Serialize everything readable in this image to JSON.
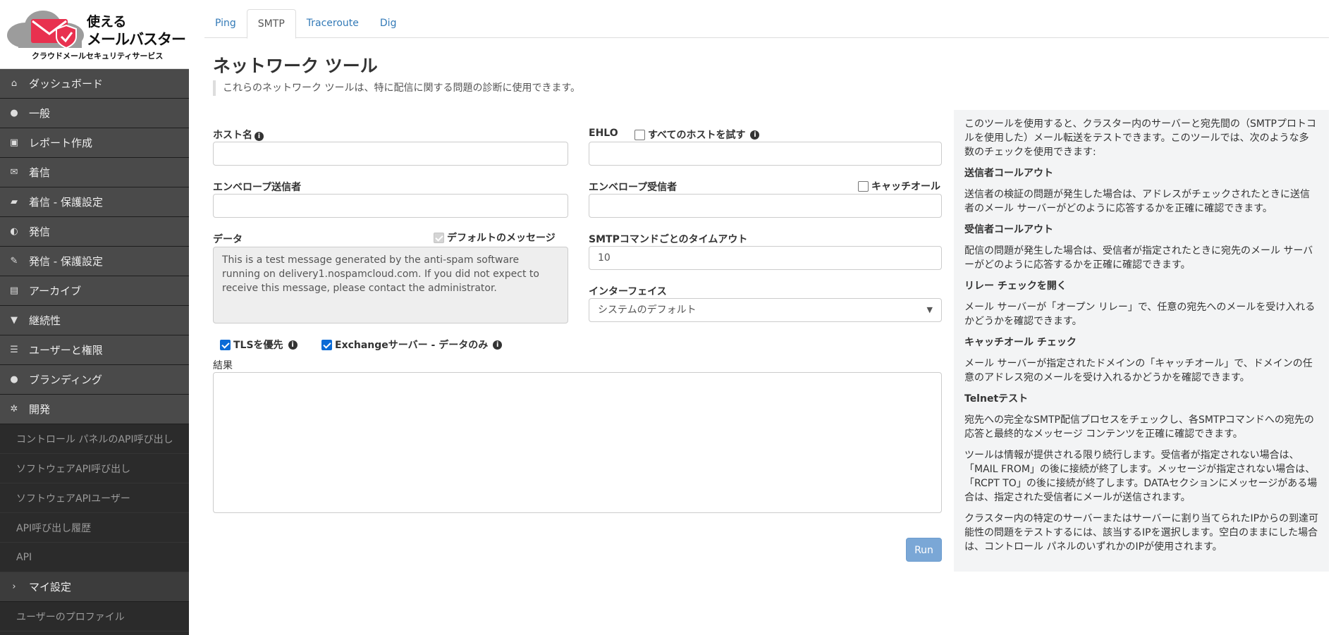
{
  "brand": {
    "name_line1": "使える",
    "name_line2": "メールバスター",
    "tagline": "クラウドメールセキュリティサービス"
  },
  "sidebar": {
    "items": [
      {
        "icon": "home-icon",
        "glyph": "⌂",
        "label": "ダッシュボード"
      },
      {
        "icon": "globe-icon",
        "glyph": "●",
        "label": "一般"
      },
      {
        "icon": "inbox-icon",
        "glyph": "▣",
        "label": "レポート作成"
      },
      {
        "icon": "envelope-icon",
        "glyph": "✉",
        "label": "着信"
      },
      {
        "icon": "folder-open-icon",
        "glyph": "▰",
        "label": "着信 - 保護設定"
      },
      {
        "icon": "half-circle-icon",
        "glyph": "◐",
        "label": "発信"
      },
      {
        "icon": "wrench-icon",
        "glyph": "✎",
        "label": "発信 - 保護設定"
      },
      {
        "icon": "file-icon",
        "glyph": "▤",
        "label": "アーカイブ"
      },
      {
        "icon": "filter-icon",
        "glyph": "▼",
        "label": "継続性"
      },
      {
        "icon": "list-icon",
        "glyph": "☰",
        "label": "ユーザーと権限"
      },
      {
        "icon": "user-icon",
        "glyph": "●",
        "label": "ブランディング"
      },
      {
        "icon": "cog-icon",
        "glyph": "✲",
        "label": "開発"
      }
    ],
    "dev_sub": [
      "コントロール パネルのAPI呼び出し",
      "ソフトウェアAPI呼び出し",
      "ソフトウェアAPIユーザー",
      "API呼び出し履歴",
      "API"
    ],
    "my_settings": {
      "icon": "chevron-right-icon",
      "glyph": "›",
      "label": "マイ設定"
    },
    "my_sub": [
      "ユーザーのプロファイル"
    ]
  },
  "tabs": [
    "Ping",
    "SMTP",
    "Traceroute",
    "Dig"
  ],
  "active_tab": "SMTP",
  "page": {
    "title": "ネットワーク ツール",
    "lead": "これらのネットワーク ツールは、特に配信に関する問題の診断に使用できます。"
  },
  "form": {
    "hostname_label": "ホスト名",
    "try_all_hosts_label": "すべてのホストを試す",
    "hostname_value": "",
    "ehlo_label": "EHLO",
    "ehlo_value": "",
    "env_sender_label": "エンベロープ送信者",
    "env_sender_value": "",
    "env_recipient_label": "エンベロープ受信者",
    "catchall_label": "キャッチオール",
    "env_recipient_value": "",
    "data_label": "データ",
    "default_message_label": "デフォルトのメッセージ",
    "data_value": "This is a test message generated by the anti-spam software running on delivery1.nospamcloud.com. If you did not expect to receive this message, please contact the administrator.",
    "timeout_label": "SMTPコマンドごとのタイムアウト",
    "timeout_value": "10",
    "interface_label": "インターフェイス",
    "interface_value": "システムのデフォルト",
    "tls_label": "TLSを優先",
    "exchange_label": "Exchangeサーバー - データのみ",
    "results_label": "結果",
    "run_label": "Run"
  },
  "help": {
    "intro": "このツールを使用すると、クラスター内のサーバーと宛先間の（SMTPプロトコルを使用した）メール転送をテストできます。このツールでは、次のような多数のチェックを使用できます:",
    "sections": [
      {
        "heading": "送信者コールアウト",
        "text": "送信者の検証の問題が発生した場合は、アドレスがチェックされたときに送信者のメール サーバーがどのように応答するかを正確に確認できます。"
      },
      {
        "heading": "受信者コールアウト",
        "text": "配信の問題が発生した場合は、受信者が指定されたときに宛先のメール サーバーがどのように応答するかを正確に確認できます。"
      },
      {
        "heading": "リレー チェックを開く",
        "text": "メール サーバーが「オープン リレー」で、任意の宛先へのメールを受け入れるかどうかを確認できます。"
      },
      {
        "heading": "キャッチオール チェック",
        "text": "メール サーバーが指定されたドメインの「キャッチオール」で、ドメインの任意のアドレス宛のメールを受け入れるかどうかを確認できます。"
      },
      {
        "heading": "Telnetテスト",
        "text": "宛先への完全なSMTP配信プロセスをチェックし、各SMTPコマンドへの宛先の応答と最終的なメッセージ コンテンツを正確に確認できます。"
      }
    ],
    "para1": "ツールは情報が提供される限り続行します。受信者が指定されない場合は、「MAIL FROM」の後に接続が終了します。メッセージが指定されない場合は、「RCPT TO」の後に接続が終了します。DATAセクションにメッセージがある場合は、指定された受信者にメールが送信されます。",
    "para2": "クラスター内の特定のサーバーまたはサーバーに割り当てられたIPからの到達可能性の問題をテストするには、該当するIPを選択します。空白のままにした場合は、コントロール パネルのいずれかのIPが使用されます。"
  }
}
